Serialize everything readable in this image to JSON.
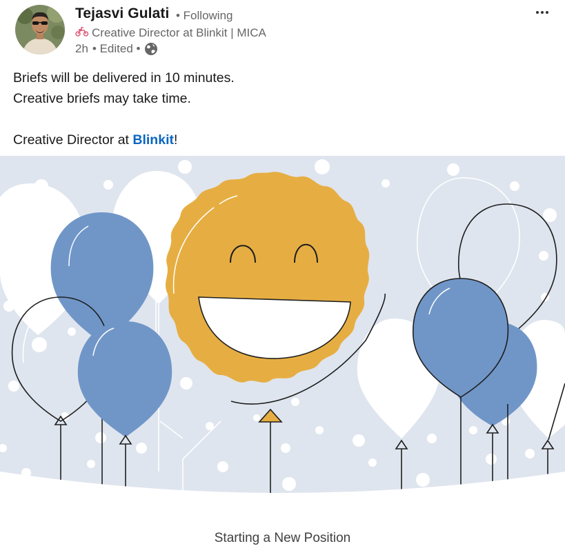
{
  "author": {
    "name": "Tejasvi Gulati",
    "follow_status": "• Following",
    "headline": "Creative Director at Blinkit | MICA",
    "headline_icon": "scooter-icon",
    "time": "2h",
    "edited": "• Edited •",
    "visibility_icon": "globe-icon"
  },
  "post": {
    "lines": [
      "Briefs will be delivered in 10 minutes.",
      "Creative briefs may take time."
    ],
    "position_prefix": "Creative Director at ",
    "company_mention": "Blinkit",
    "position_suffix": "!"
  },
  "card": {
    "caption": "Starting a New Position"
  },
  "colors": {
    "banner_background": "#dfe5ee",
    "sun": "#e6ae42",
    "balloon_blue": "#7096c8",
    "mention": "#0a66c2"
  }
}
